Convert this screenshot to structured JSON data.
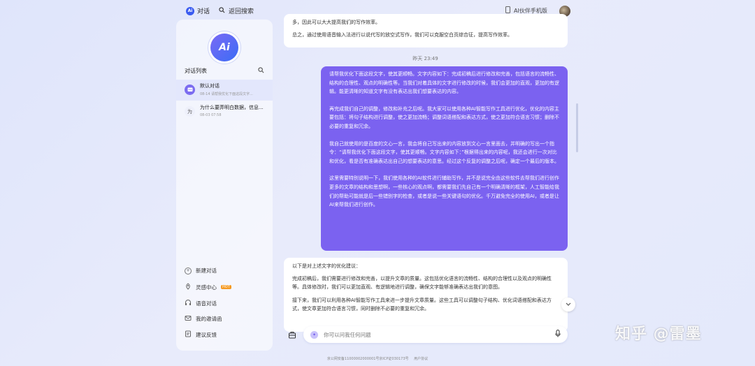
{
  "topbar": {
    "brand_badge": "Ai",
    "brand_label": "对话",
    "back_search_label": "返回搜索",
    "partner_label": "AI伙伴手机版"
  },
  "sidebar": {
    "logo_text": "Ai",
    "list_title": "对话列表",
    "conversations": [
      {
        "icon_text": "",
        "title": "默认对话",
        "subtitle": "08-14   请帮我优化下面这段文字..."
      },
      {
        "icon_text": "为",
        "title": "为什么要弄明白数据，信息...",
        "subtitle": "08-03 07:58"
      }
    ],
    "menu": [
      {
        "label": "新建对话",
        "icon": "plus-circle-icon"
      },
      {
        "label": "灵感中心",
        "icon": "location-pin-icon",
        "badge": "HOT"
      },
      {
        "label": "语音对话",
        "icon": "headphones-icon"
      },
      {
        "label": "我的邀请函",
        "icon": "envelope-icon"
      },
      {
        "label": "建议反馈",
        "icon": "feedback-icon"
      }
    ]
  },
  "chat": {
    "prev_ai_lines": [
      "多，因此可以大大提高我们的写作效率。",
      "总之，通过使用语音输入法进行以说代写的放空式写作，我们可以克服空白页综合征，提高写作效率。"
    ],
    "time_divider": "昨天 23:49",
    "user_message": [
      "请帮我优化下面这段文字，使其更顺畅。文字内容如下：完成初稿后进行修改和完善，包括语言的流畅性、结构的合理性、观点的明确性等。当我们对着具体的文字进行修改的时候，我们会更加的直观，更加的有逻辑。能更清晰的知道文字有没有表达出我们想要表达的内容。",
      "再完成我们自己的调整，修改和补充之后呢。我大家可以使用各种AI智能写作工具进行优化，优化的内容主要包括：将句子结构进行调整，使之更加流畅；调整词语搭配和表达方式，使之更加符合语言习惯；删除不必要的重复和冗余。",
      "我自己就使用的是百度的文心一言，我会将自己写出来的内容放到文心一言里面去，并明确的写出一个指令：“请帮我优化下面这段文字，使其更顺畅。文字内容如下：”根据得出来的内容呢，我还会进行一次对比和优化，看是否有准确表达出自己的想要表达的意思。经过这个反复的调整之后呢，确定一个最后的版本。",
      "这里需要特别说明一下，我们使用各种的AI软件进行辅助写作，并不是说完全由这些软件去帮我们进行创作更多的文章的结构和思想啊，一些核心的观点啊，都需要我们先自己有一个明确清晰的框架，人工智能给我们的帮助可能就是后一些错别字的检查，或者是说一些关键语句的优化。千万避免完全的使用AI，或者是让AI来帮我们进行创作。"
    ],
    "ai_reply": [
      "以下是对上述文字的优化建议：",
      "完成初稿后，我们需要进行修改和完善，以提升文章的质量。这包括优化语言的流畅性、结构的合理性以及观点的明确性等。具体修改时，我们可以更加直观、有逻辑地进行调整，确保文字能够准确表达出我们的意图。",
      "接下来，我们可以利用各种AI智能写作工具来进一步提升文章质量。这些工具可以调整句子结构、优化词语搭配和表达方式，使文章更加符合语言习惯，同时删除不必要的重复和冗余。"
    ],
    "input_placeholder": "你可以问我任何问题"
  },
  "footer": {
    "icp": "京公网安备11000002000001号京ICP证030173号",
    "agreement": "用户协议"
  },
  "watermark": "知乎 @雷墨"
}
